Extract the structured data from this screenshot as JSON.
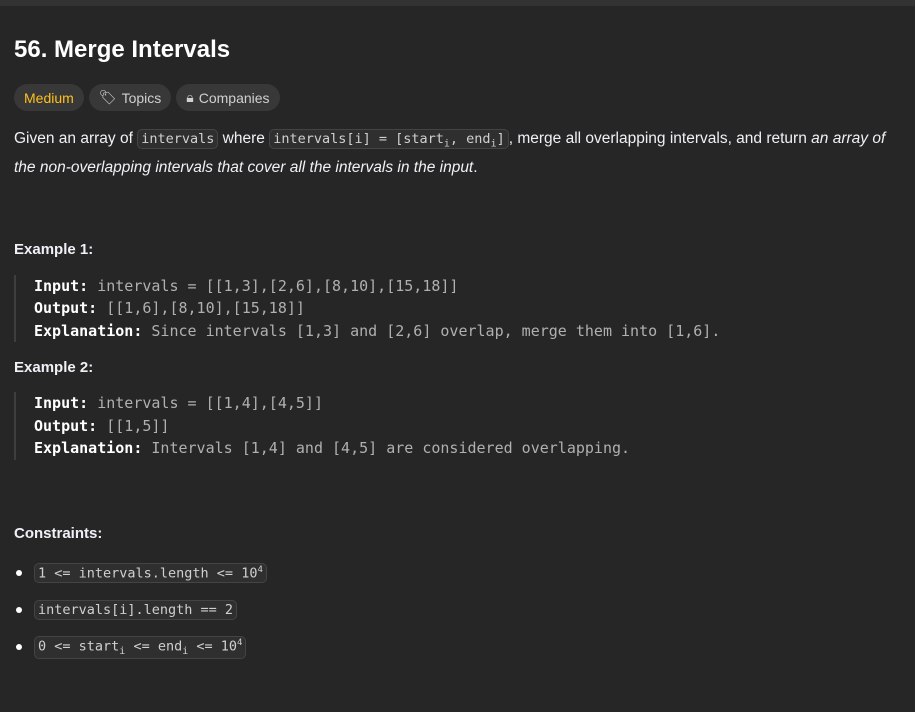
{
  "title": "56. Merge Intervals",
  "tags": {
    "difficulty": "Medium",
    "topics": "Topics",
    "companies": "Companies",
    "colors": {
      "medium": "#ffc01e"
    }
  },
  "description": {
    "t1": "Given an array of ",
    "c1": "intervals",
    "t2": " where ",
    "c2a": "intervals[i] = [start",
    "sub_i": "i",
    "c2b": ", end",
    "c2c": "]",
    "t3": ", merge all overlapping intervals, and return ",
    "em": "an array of the non-overlapping intervals that cover all the intervals in the input",
    "t4": "."
  },
  "examples": [
    {
      "heading": "Example 1:",
      "input_label": "Input:",
      "input": " intervals = [[1,3],[2,6],[8,10],[15,18]]",
      "output_label": "Output:",
      "output": " [[1,6],[8,10],[15,18]]",
      "explanation_label": "Explanation:",
      "explanation": " Since intervals [1,3] and [2,6] overlap, merge them into [1,6]."
    },
    {
      "heading": "Example 2:",
      "input_label": "Input:",
      "input": " intervals = [[1,4],[4,5]]",
      "output_label": "Output:",
      "output": " [[1,5]]",
      "explanation_label": "Explanation:",
      "explanation": " Intervals [1,4] and [4,5] are considered overlapping."
    }
  ],
  "constraints": {
    "heading": "Constraints:",
    "c1": "1 <= intervals.length <= 10",
    "c1_sup": "4",
    "c2": "intervals[i].length == 2",
    "c3a": "0 <= start",
    "c3_sub1": "i",
    "c3b": " <= end",
    "c3_sub2": "i",
    "c3c": " <= 10",
    "c3_sup": "4"
  }
}
